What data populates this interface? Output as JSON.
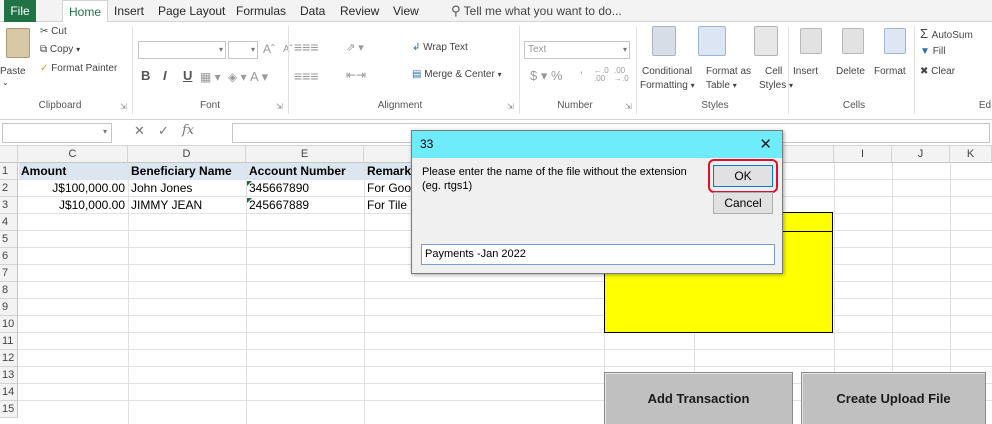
{
  "ribbon_tabs": [
    {
      "label": "File"
    },
    {
      "label": "Home"
    },
    {
      "label": "Insert"
    },
    {
      "label": "Page Layout"
    },
    {
      "label": "Formulas"
    },
    {
      "label": "Data"
    },
    {
      "label": "Review"
    },
    {
      "label": "View"
    }
  ],
  "tell_me": "Tell me what you want to do...",
  "groups": {
    "clipboard": {
      "label": "Clipboard",
      "paste": "Paste",
      "cut": "Cut",
      "copy": "Copy",
      "format_painter": "Format Painter"
    },
    "font": {
      "label": "Font"
    },
    "alignment": {
      "label": "Alignment",
      "wrap_text": "Wrap Text",
      "merge_center": "Merge & Center"
    },
    "number": {
      "label": "Number",
      "format": "Text"
    },
    "styles": {
      "label": "Styles",
      "conditional": "Conditional",
      "formatting": "Formatting",
      "format_as": "Format as",
      "table": "Table",
      "cell": "Cell",
      "styles_btn": "Styles"
    },
    "cells": {
      "label": "Cells",
      "insert": "Insert",
      "delete": "Delete",
      "format": "Format"
    },
    "editing": {
      "label": "Ed",
      "autosum": "AutoSum",
      "fill": "Fill",
      "clear": "Clear"
    }
  },
  "formula_bar": {
    "fx": "fx"
  },
  "columns": [
    "C",
    "D",
    "E",
    "I",
    "J",
    "K"
  ],
  "rows": [
    "1",
    "2",
    "3",
    "4",
    "5",
    "6",
    "7",
    "8",
    "9",
    "10",
    "11",
    "12",
    "13",
    "14",
    "15"
  ],
  "table": {
    "headers": [
      "Amount",
      "Beneficiary Name",
      "Account Number",
      "Remark"
    ],
    "rows": [
      [
        "J$100,000.00",
        "John Jones",
        "345667890",
        "For Goo"
      ],
      [
        "J$10,000.00",
        "JIMMY JEAN",
        "245667889",
        "For Tile"
      ]
    ]
  },
  "sheet_buttons": {
    "add": "Add Transaction",
    "create": "Create Upload File"
  },
  "dialog": {
    "title": "33",
    "message": "Please enter the name of the file without the extension (eg. rtgs1)",
    "ok": "OK",
    "cancel": "Cancel",
    "input_value": "Payments -Jan 2022"
  },
  "colors": {
    "excel_green": "#217346",
    "dialog_title": "#6eecfc",
    "highlight_ring": "#e0102a",
    "shape_fill": "#ffff00",
    "header_fill": "#dce6f1"
  }
}
